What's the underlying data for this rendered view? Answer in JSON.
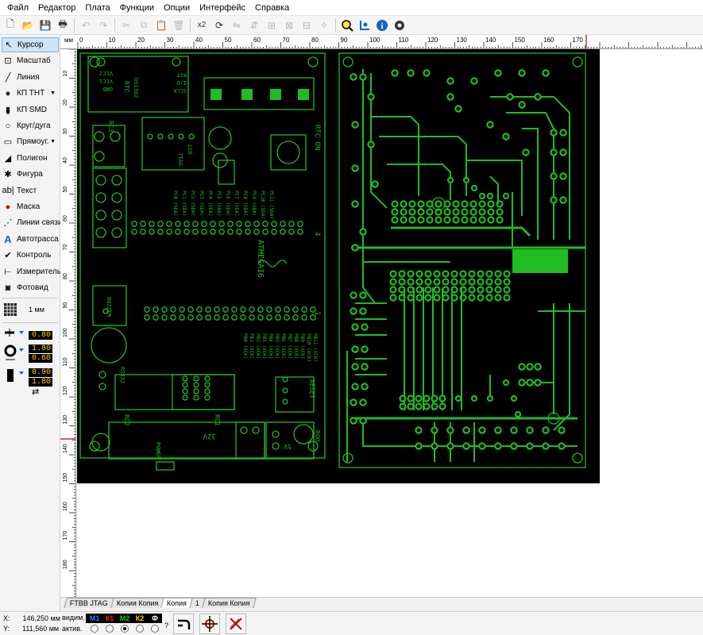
{
  "menu": [
    "Файл",
    "Редактор",
    "Плата",
    "Функции",
    "Опции",
    "Интерфейс",
    "Справка"
  ],
  "toolbar": {
    "icons": [
      "new-file-icon",
      "open-folder-icon",
      "save-icon",
      "print-icon",
      "undo-icon",
      "redo-icon",
      "cut-icon",
      "copy-icon",
      "paste-icon",
      "delete-icon",
      "duplicate-icon",
      "rotate-icon",
      "mirror-h-icon",
      "mirror-v-icon",
      "align-icon",
      "group-icon",
      "ungroup-icon",
      "select-all-icon",
      "zoom-search-icon",
      "coordinates-icon",
      "info-icon",
      "settings-icon"
    ],
    "duplicate_label": "x2"
  },
  "tools": [
    {
      "label": "Курсор",
      "icon": "cursor-icon",
      "glyph": "↖",
      "active": true
    },
    {
      "label": "Масштаб",
      "icon": "zoom-icon",
      "glyph": "⊡"
    },
    {
      "label": "Линия",
      "icon": "line-icon",
      "glyph": "╱"
    },
    {
      "label": "КП THT",
      "icon": "pad-tht-icon",
      "glyph": "●",
      "has_arrow": true
    },
    {
      "label": "КП SMD",
      "icon": "pad-smd-icon",
      "glyph": "▮"
    },
    {
      "label": "Круг/дуга",
      "icon": "circle-icon",
      "glyph": "○"
    },
    {
      "label": "Прямоуг.",
      "icon": "rectangle-icon",
      "glyph": "▭",
      "has_arrow": true
    },
    {
      "label": "Полигон",
      "icon": "polygon-icon",
      "glyph": "◢"
    },
    {
      "label": "Фигура",
      "icon": "shape-icon",
      "glyph": "✱"
    },
    {
      "label": "Текст",
      "icon": "text-icon",
      "glyph": "ab|"
    },
    {
      "label": "Маска",
      "icon": "mask-icon",
      "glyph": "●",
      "color": "#d00000"
    },
    {
      "label": "Линии связи",
      "icon": "airwire-icon",
      "glyph": "⋰"
    },
    {
      "label": "Автотрасса",
      "icon": "autoroute-icon",
      "glyph": "A",
      "color": "#1a5fb4"
    },
    {
      "label": "Контроль",
      "icon": "drc-icon",
      "glyph": "✔"
    },
    {
      "label": "Измеритель",
      "icon": "measure-icon",
      "glyph": "⊢"
    },
    {
      "label": "Фотовид",
      "icon": "photoview-icon",
      "glyph": "◙"
    }
  ],
  "grid": {
    "label": "1 мм"
  },
  "widths": {
    "track": "0.80",
    "pad_outer": "1.80",
    "pad_inner": "0.60",
    "smd_w": "0.90",
    "smd_h": "1.80"
  },
  "ruler": {
    "unit": "мм",
    "top_labels": [
      "0",
      "10",
      "20",
      "30",
      "40",
      "50",
      "60",
      "70",
      "80",
      "90",
      "100",
      "110",
      "120",
      "130",
      "140",
      "150",
      "160",
      "170"
    ]
  },
  "tabs": [
    {
      "label": "FTBB JTAG",
      "active": false
    },
    {
      "label": "Копия  Копия",
      "active": false
    },
    {
      "label": "Копия",
      "active": true
    },
    {
      "label": "1",
      "active": false
    },
    {
      "label": "Копия  Копия",
      "active": false
    }
  ],
  "status": {
    "x_label": "X:",
    "x_value": "146,250 мм",
    "y_label": "Y:",
    "y_value": "111,560 мм",
    "visible_label": "видим.",
    "active_label": "актив.",
    "layers": [
      {
        "name": "М1",
        "color": "#3c78ff"
      },
      {
        "name": "К1",
        "color": "#ff2020"
      },
      {
        "name": "М2",
        "color": "#20c020"
      },
      {
        "name": "К2",
        "color": "#ffd000"
      },
      {
        "name": "Ф",
        "color": "#ffffff"
      }
    ],
    "active_layer_index": 2,
    "question": "?"
  },
  "board": {
    "colors": {
      "background": "#000000",
      "copper": "#22bb22"
    },
    "silk_labels": [
      "ATMEGA16",
      "RTC ON",
      "RESET",
      "RS232",
      "BUZZER",
      "ROO",
      "REG",
      "32V",
      "5V",
      "GND",
      "VCC",
      "RC1",
      "RC2",
      "RC3",
      "RST",
      "I/O",
      "SCLK",
      "VCC1",
      "VCC2",
      "LCD",
      "JTAG",
      "TXD",
      "RXD"
    ]
  }
}
